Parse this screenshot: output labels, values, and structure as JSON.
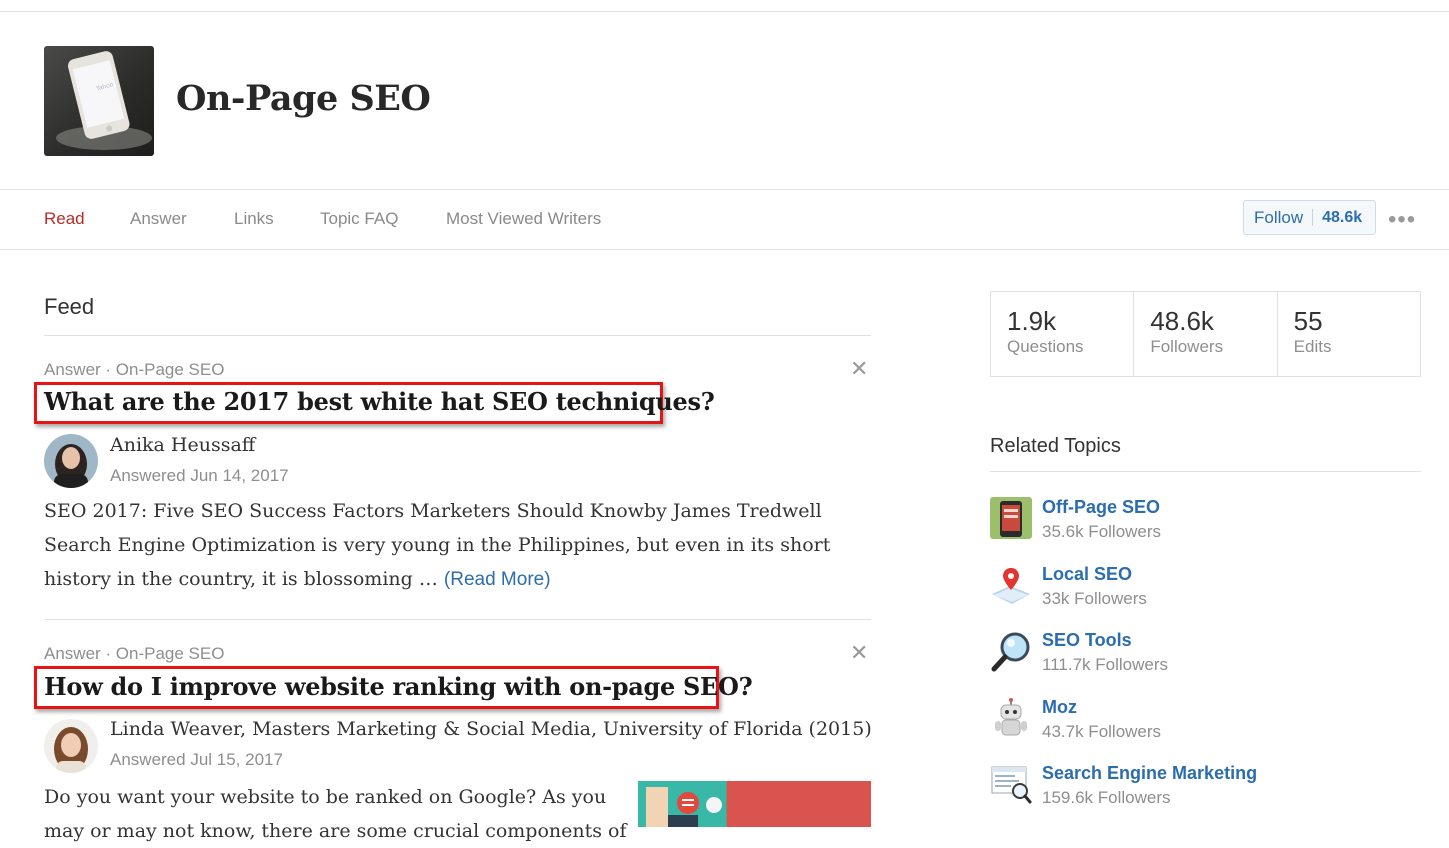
{
  "topic": {
    "title": "On-Page SEO",
    "photo_icon": "iphone-photo",
    "photo_screen_text": "Yahoo"
  },
  "nav": {
    "tabs": [
      {
        "label": "Read",
        "active": true
      },
      {
        "label": "Answer",
        "active": false
      },
      {
        "label": "Links",
        "active": false
      },
      {
        "label": "Topic FAQ",
        "active": false
      },
      {
        "label": "Most Viewed Writers",
        "active": false
      }
    ],
    "follow_label": "Follow",
    "follow_count": "48.6k",
    "more_icon": "ellipsis-icon"
  },
  "feed": {
    "title": "Feed",
    "items": [
      {
        "meta": "Answer · On-Page SEO",
        "question": "What are the 2017 best white hat SEO techniques?",
        "author": "Anika Heussaff",
        "answered": "Answered Jun 14, 2017",
        "snippet": "SEO 2017: Five SEO Success Factors Marketers Should Knowby James Tredwell Search Engine Optimization is very young in the Philippines, but even in its short history in the country, it is blossoming …",
        "read_more": "(Read More)"
      },
      {
        "meta": "Answer · On-Page SEO",
        "question": "How do I improve website ranking with on-page SEO?",
        "author": "Linda Weaver, Masters Marketing & Social Media, University of Florida (2015)",
        "answered": "Answered Jul 15, 2017",
        "snippet_line1": "Do you want your website to be ranked on Google? As you",
        "snippet_line2": "may or may not know, there are some crucial components of"
      }
    ]
  },
  "stats": {
    "questions_value": "1.9k",
    "questions_label": "Questions",
    "followers_value": "48.6k",
    "followers_label": "Followers",
    "edits_value": "55",
    "edits_label": "Edits"
  },
  "related": {
    "title": "Related Topics",
    "items": [
      {
        "name": "Off-Page SEO",
        "followers": "35.6k Followers",
        "icon": "phone-app-icon"
      },
      {
        "name": "Local SEO",
        "followers": "33k Followers",
        "icon": "map-pin-icon"
      },
      {
        "name": "SEO Tools",
        "followers": "111.7k Followers",
        "icon": "magnifier-icon"
      },
      {
        "name": "Moz",
        "followers": "43.7k Followers",
        "icon": "robot-icon"
      },
      {
        "name": "Search Engine Marketing",
        "followers": "159.6k Followers",
        "icon": "search-screen-icon"
      }
    ]
  },
  "colors": {
    "active_tab": "#b92b27",
    "link": "#2b6dad",
    "highlight_box": "#e51515"
  }
}
